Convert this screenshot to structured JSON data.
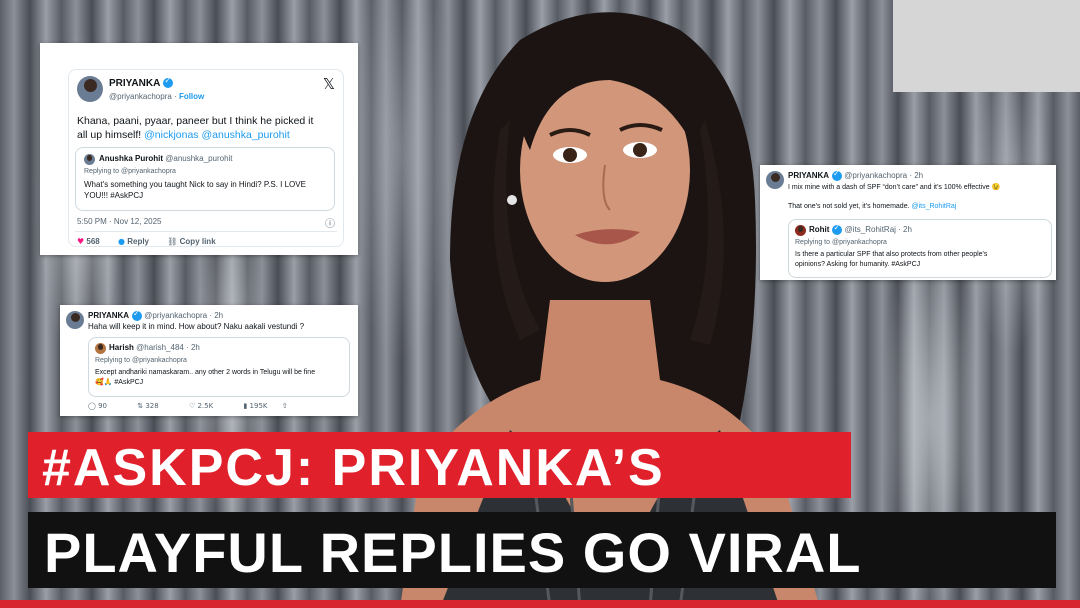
{
  "tweet1": {
    "name": "PRIYANKA",
    "handle_line": "@priyankachopra · ",
    "follow": "Follow",
    "x_logo": "𝕏",
    "text_line1": "Khana, paani, pyaar, paneer but I think he picked it",
    "text_line2_plain": "all up himself! ",
    "text_line2_links": "@nickjonas @anushka_purohit",
    "quote": {
      "name": "Anushka Purohit",
      "handle": "@anushka_purohit",
      "replying": "Replying to @priyankachopra",
      "text_line1": "What's something you taught Nick to say in Hindi? P.S. I LOVE",
      "text_line2": "YOU!!! #AskPCJ"
    },
    "timestamp": "5:50 PM · Nov 12, 2025",
    "likes": "568",
    "reply_label": "Reply",
    "copy_label": "Copy link"
  },
  "tweet2": {
    "name": "PRIYANKA",
    "handle_line": "@priyankachopra · 2h",
    "text": "Haha will keep it in mind. How about? Naku aakali vestundi ?",
    "quote": {
      "name": "Harish",
      "handle": "@harish_484 · 2h",
      "replying": "Replying to @priyankachopra",
      "text_line1": "Except andhariki namaskaram.. any other 2 words in Telugu will be fine",
      "text_line2": "🥰🙏 #AskPCJ"
    },
    "stats": {
      "replies": "90",
      "retweets": "328",
      "likes": "2.5K",
      "views": "195K"
    }
  },
  "tweet3": {
    "name": "PRIYANKA",
    "handle_line": "@priyankachopra · 2h",
    "text_line1": "I mix mine with a dash of SPF “don’t care” and it’s 100% effective 😉",
    "text_line2_plain": "That one’s not sold yet, it’s homemade. ",
    "text_line2_link": "@its_RohitRaj",
    "quote": {
      "name": "Rohit",
      "handle": "@its_RohitRaj · 2h",
      "replying": "Replying to @priyankachopra",
      "text_line1": "Is there a particular SPF that also protects from other people's",
      "text_line2": "opinions? Asking for humanity. #AskPCJ"
    }
  },
  "headline": {
    "line1": "#ASKPCJ: PRIYANKA’S",
    "line2": "PLAYFUL REPLIES GO VIRAL"
  },
  "colors": {
    "banner_red": "#e0212b",
    "banner_black": "#111111",
    "link_blue": "#1d9bf0",
    "like_pink": "#f91880"
  }
}
